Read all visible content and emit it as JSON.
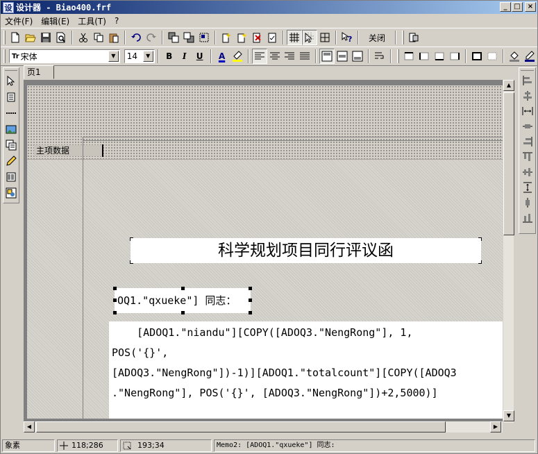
{
  "window": {
    "title": "设计器 - Biao400.frf",
    "icon_glyph": "设",
    "controls": {
      "minimize": "_",
      "maximize": "□",
      "close": "×"
    }
  },
  "menubar": [
    "文件(F)",
    "编辑(E)",
    "工具(T)",
    "?"
  ],
  "toolbar1": {
    "icons": [
      "new-icon",
      "open-icon",
      "save-icon",
      "preview-icon",
      "cut-icon",
      "copy-icon",
      "paste-icon",
      "undo-icon",
      "redo-icon",
      "bring-front-icon",
      "send-back-icon",
      "group-icon",
      "add-page-icon",
      "new-page-icon",
      "delete-page-icon",
      "page-setup-icon",
      "grid-icon",
      "grid-align-icon",
      "fit-grid-icon",
      "help-icon",
      "exit-icon"
    ],
    "close_label": "关闭"
  },
  "toolbar2": {
    "font_name": "宋体",
    "font_size": "14",
    "bold": "B",
    "italic": "I",
    "underline": "U",
    "text_color": "A",
    "colors": {
      "accent": "#0a246a",
      "font_color": "#0000c0",
      "highlight": "#ffff00"
    }
  },
  "tabs": [
    "页1"
  ],
  "band": {
    "label": "主项数据"
  },
  "memos": {
    "title": "科学规划项目同行评议函",
    "greeting": "OQ1.\"qxueke\"] 同志：",
    "content": "    [ADOQ1.\"niandu\"][COPY([ADOQ3.\"NengRong\"], 1,\nPOS('{}',\n[ADOQ3.\"NengRong\"])-1)][ADOQ1.\"totalcount\"][COPY([ADOQ3\n.\"NengRong\"], POS('{}', [ADOQ3.\"NengRong\"])+2,5000)]"
  },
  "statusbar": {
    "unit": "象素",
    "position": "118;286",
    "size": "193;34",
    "info": "Memo2: [ADOQ1.\"qxueke\"] 同志:"
  }
}
